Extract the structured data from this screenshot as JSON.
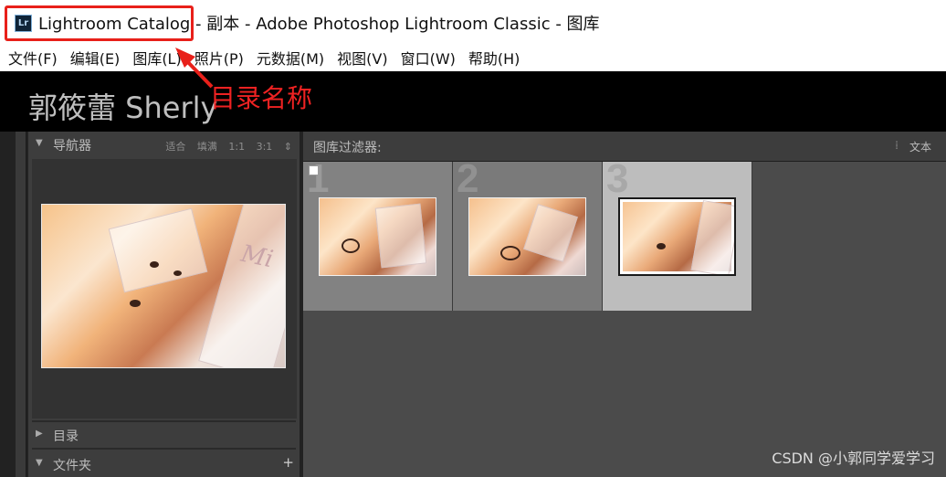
{
  "window": {
    "title": "Lightroom Catalog - 副本 - Adobe Photoshop Lightroom Classic - 图库",
    "app_icon_text": "Lr"
  },
  "menu": {
    "items": [
      {
        "label": "文件(F)"
      },
      {
        "label": "编辑(E)"
      },
      {
        "label": "图库(L)"
      },
      {
        "label": "照片(P)"
      },
      {
        "label": "元数据(M)"
      },
      {
        "label": "视图(V)"
      },
      {
        "label": "窗口(W)"
      },
      {
        "label": "帮助(H)"
      }
    ]
  },
  "identity_plate": {
    "name": "郭筱蕾 Sherly"
  },
  "annotation": {
    "label": "目录名称",
    "color": "#ee2222"
  },
  "navigator": {
    "title": "导航器",
    "options": [
      "适合",
      "填满",
      "1:1",
      "3:1"
    ]
  },
  "panels": {
    "catalog": "目录",
    "folders": "文件夹"
  },
  "library_filter": {
    "title": "图库过滤器:",
    "text_option": "文本"
  },
  "grid": {
    "cells": [
      {
        "index": "1",
        "selected": false
      },
      {
        "index": "2",
        "selected": false
      },
      {
        "index": "3",
        "selected": true
      }
    ]
  },
  "watermark": "CSDN @小郭同学爱学习"
}
